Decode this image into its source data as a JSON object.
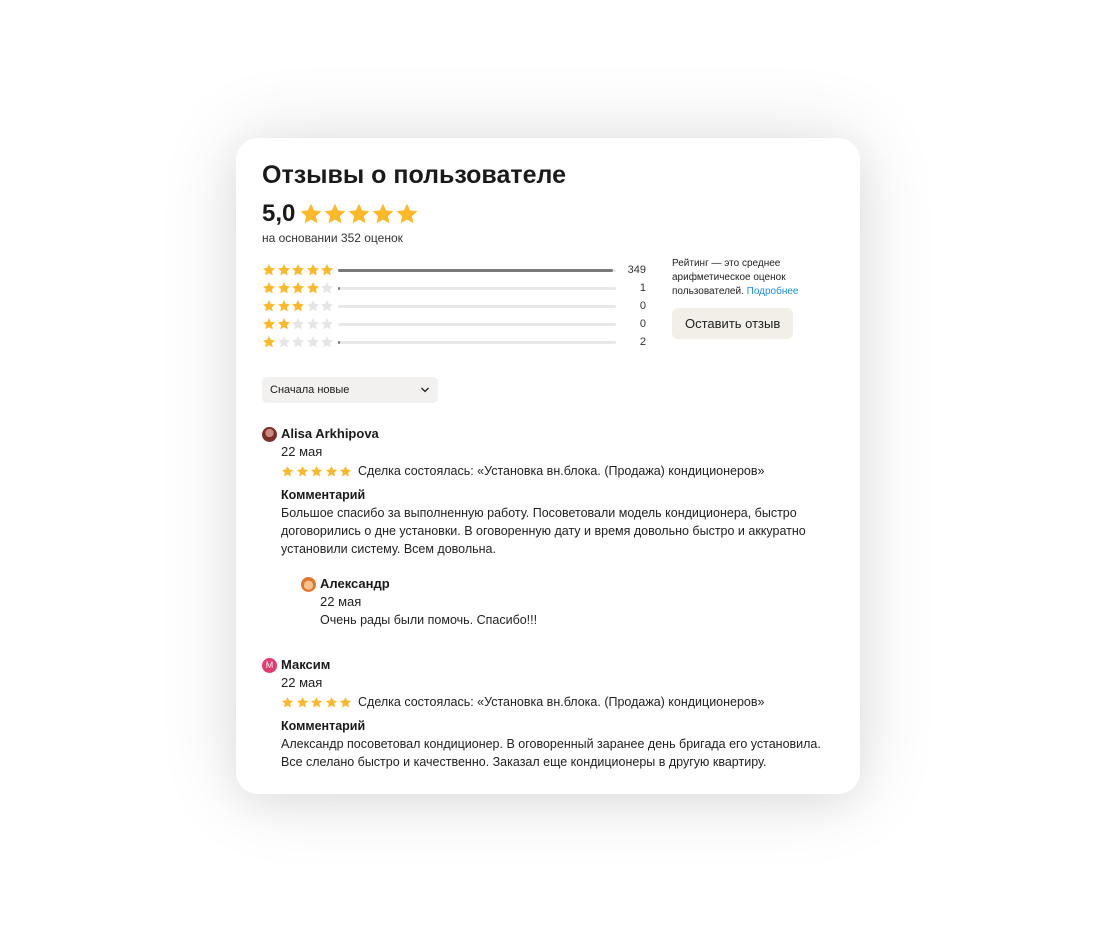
{
  "title": "Отзывы о пользователе",
  "rating": {
    "value": "5,0",
    "stars": 5,
    "based_on": "на основании 352 оценок"
  },
  "distribution": [
    {
      "stars": 5,
      "count": "349",
      "fraction": 0.99
    },
    {
      "stars": 4,
      "count": "1",
      "fraction": 0.003
    },
    {
      "stars": 3,
      "count": "0",
      "fraction": 0.0
    },
    {
      "stars": 2,
      "count": "0",
      "fraction": 0.0
    },
    {
      "stars": 1,
      "count": "2",
      "fraction": 0.006
    }
  ],
  "info": {
    "text": "Рейтинг — это среднее арифметическое оценок пользователей.",
    "link": "Подробнее"
  },
  "leave_review_label": "Оставить отзыв",
  "sort": {
    "label": "Сначала новые",
    "icon": "chevron-down-icon"
  },
  "reviews": [
    {
      "author": "Alisa Arkhipova",
      "date": "22 мая",
      "stars": 5,
      "deal": "Сделка состоялась: «Установка вн.блока. (Продажа) кондиционеров»",
      "comment_label": "Комментарий",
      "comment": "Большое спасибо за выполненную работу. Посоветовали модель кондиционера, быстро договорились о дне установки. В оговоренную дату и время довольно быстро и аккуратно установили систему. Всем довольна.",
      "reply": {
        "author": "Александр",
        "date": "22 мая",
        "text": "Очень рады были помочь. Спасибо!!!"
      }
    },
    {
      "author": "Максим",
      "avatar_letter": "М",
      "date": "22 мая",
      "stars": 5,
      "deal": "Сделка состоялась: «Установка вн.блока. (Продажа) кондиционеров»",
      "comment_label": "Комментарий",
      "comment": "Александр посоветовал кондиционер. В оговоренный заранее день бригада его установила. Все слелано быстро и качественно. Заказал еще кондиционеры в другую квартиру."
    }
  ],
  "colors": {
    "star": "#fbb829",
    "star_empty": "#e6e6e6",
    "link": "#1a8de0",
    "button_bg": "#f2efe8"
  }
}
